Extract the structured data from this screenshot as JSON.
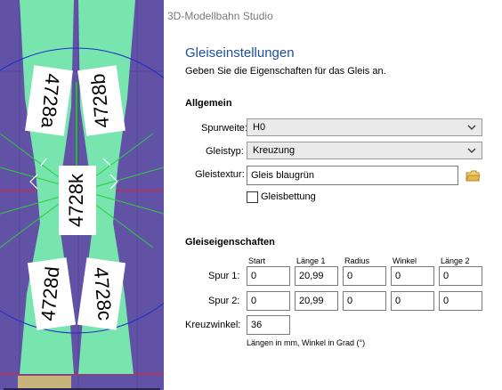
{
  "canvas": {
    "labels": [
      "4728a",
      "4728b",
      "4728k",
      "4728d",
      "4728c"
    ],
    "colors": {
      "background": "#6252a6",
      "track": "#78e5ae",
      "label_bg": "#ffffff",
      "circle": "#1f2cc9"
    }
  },
  "dialog": {
    "window_title": "3D-Modellbahn Studio",
    "heading": "Gleiseinstellungen",
    "subtitle": "Geben Sie die Eigenschaften für das Gleis an.",
    "general": {
      "title": "Allgemein",
      "spurweite_label": "Spurweite:",
      "spurweite_value": "H0",
      "gleistyp_label": "Gleistyp:",
      "gleistyp_value": "Kreuzung",
      "gleistextur_label": "Gleistextur:",
      "gleistextur_value": "Gleis blaugrün",
      "folder_icon": "folder-icon",
      "gleisbettung_label": "Gleisbettung",
      "gleisbettung_checked": false
    },
    "props": {
      "title": "Gleiseigenschaften",
      "columns": [
        "Start",
        "Länge 1",
        "Radius",
        "Winkel",
        "Länge 2"
      ],
      "rows": [
        {
          "label": "Spur 1:",
          "values": [
            "0",
            "20,99",
            "0",
            "0",
            "0"
          ]
        },
        {
          "label": "Spur 2:",
          "values": [
            "0",
            "20,99",
            "0",
            "0",
            "0"
          ]
        }
      ],
      "kreuzwinkel_label": "Kreuzwinkel:",
      "kreuzwinkel_value": "36",
      "note": "Längen in mm, Winkel in Grad (°)"
    },
    "colors": {
      "heading": "#1e4fa0",
      "title": "#7a7a7a",
      "combo_bg": "#eaeaea",
      "folder": "#e6b84a"
    }
  }
}
